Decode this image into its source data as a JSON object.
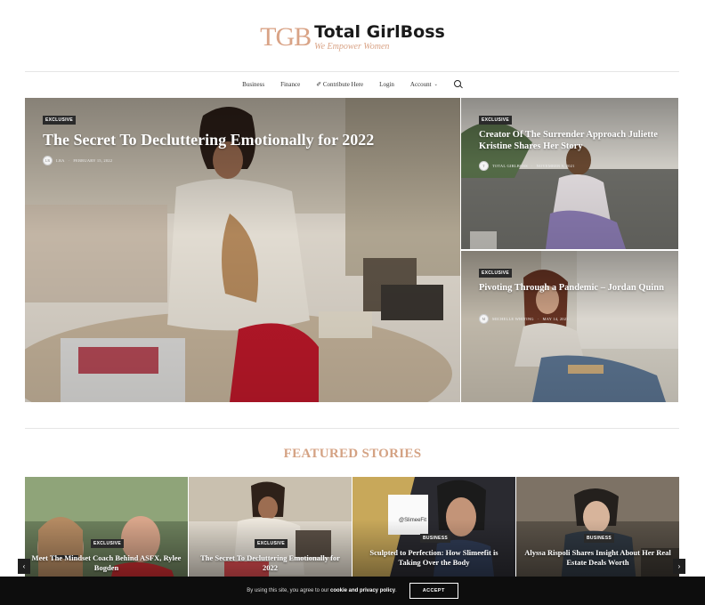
{
  "site": {
    "logo_mark": "TGB",
    "logo_title": "Total GirlBoss",
    "logo_tagline": "We Empower Women"
  },
  "nav": {
    "items": [
      {
        "label": "Business"
      },
      {
        "label": "Finance"
      },
      {
        "label": "✐ Contribute Here"
      },
      {
        "label": "Login"
      },
      {
        "label": "Account"
      }
    ],
    "search_icon": "search-icon",
    "account_icon": "chevron-down-icon"
  },
  "hero": {
    "main": {
      "badge": "EXCLUSIVE",
      "title": "The Secret To Decluttering Emotionally for 2022",
      "author": "LRA",
      "date": "FEBRUARY 15, 2022"
    },
    "side": [
      {
        "badge": "EXCLUSIVE",
        "title": "Creator Of The Surrender Approach Juliette Kristine Shares Her Story",
        "author": "TOTAL GIRLBOSS",
        "date": "NOVEMBER 9, 2021"
      },
      {
        "badge": "EXCLUSIVE",
        "title": "Pivoting Through a Pandemic – Jordan Quinn",
        "author": "MICHELLE WHITING",
        "date": "MAY 14, 2021"
      }
    ]
  },
  "featured": {
    "heading": "FEATURED STORIES",
    "items": [
      {
        "badge": "EXCLUSIVE",
        "title": "Meet The Mindset Coach Behind ASFX, Rylee Bogden"
      },
      {
        "badge": "EXCLUSIVE",
        "title": "The Secret To Decluttering Emotionally for 2022"
      },
      {
        "badge": "BUSINESS",
        "title": "Sculpted to Perfection: How Slimeefit is Taking Over the Body"
      },
      {
        "badge": "BUSINESS",
        "title": "Alyssa Rispoli Shares Insight About Her Real Estate Deals Worth"
      }
    ],
    "prev_icon": "chevron-left-icon",
    "next_icon": "chevron-right-icon",
    "brand_overlay": "@SlimeeFit"
  },
  "cookie": {
    "text_prefix": "By using this site, you agree to our ",
    "text_link": "cookie and privacy policy",
    "text_suffix": ".",
    "accept_label": "ACCEPT"
  }
}
